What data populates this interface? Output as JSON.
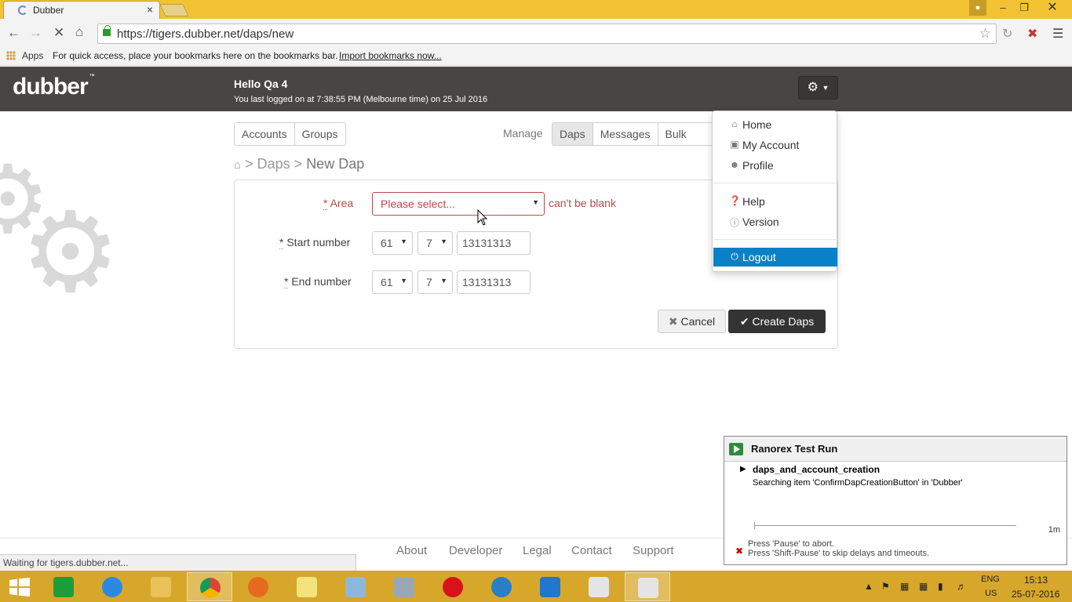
{
  "browser": {
    "tab_title": "Dubber",
    "tab_close": "×",
    "url": "https://tigers.dubber.net/daps/new",
    "bookmarks": {
      "apps_label": "Apps",
      "hint": "For quick access, place your bookmarks here on the bookmarks bar.",
      "import_link": "Import bookmarks now..."
    },
    "status_text": "Waiting for tigers.dubber.net..."
  },
  "header": {
    "logo": "dubber",
    "logo_tm": "™",
    "greeting": "Hello Qa 4",
    "last_login": "You last logged on at 7:38:55 PM (Melbourne time) on 25 Jul 2016"
  },
  "subnav": {
    "left_group": [
      "Accounts",
      "Groups"
    ],
    "manage_label": "Manage",
    "right_group": [
      {
        "label": "Daps",
        "active": true
      },
      {
        "label": "Messages",
        "active": false
      },
      {
        "label": "Bulk Man",
        "active": false
      }
    ]
  },
  "breadcrumb": {
    "sep1": ">",
    "parent": "Daps",
    "sep2": ">",
    "current": "New Dap"
  },
  "form": {
    "area": {
      "label": "Area",
      "required_mark": "*",
      "placeholder": "Please select...",
      "error": "can't be blank"
    },
    "start": {
      "label": "Start number",
      "required_mark": "*",
      "country": "61",
      "area_code": "7",
      "number": "13131313"
    },
    "end": {
      "label": "End number",
      "required_mark": "*",
      "country": "61",
      "area_code": "7",
      "number": "13131313"
    },
    "cancel_label": "Cancel",
    "create_label": "Create Daps"
  },
  "menu": {
    "items": [
      {
        "label": "Home",
        "icon": "home-icon"
      },
      {
        "label": "My Account",
        "icon": "briefcase-icon"
      },
      {
        "label": "Profile",
        "icon": "user-icon"
      },
      {
        "label": "Help",
        "icon": "question-icon"
      },
      {
        "label": "Version",
        "icon": "info-icon"
      },
      {
        "label": "Logout",
        "icon": "power-icon"
      }
    ]
  },
  "footer": {
    "links": [
      "About",
      "Developer",
      "Legal",
      "Contact",
      "Support"
    ]
  },
  "ranorex": {
    "title": "Ranorex Test Run",
    "test_case": "daps_and_account_creation",
    "message": "Searching item 'ConfirmDapCreationButton' in 'Dubber'",
    "duration": "1m",
    "hint1": "Press 'Pause' to abort.",
    "hint2": "Press 'Shift-Pause' to skip delays and timeouts."
  },
  "taskbar": {
    "lang_top": "ENG",
    "lang_bottom": "US",
    "time": "15:13",
    "date": "25-07-2016"
  },
  "colors": {
    "header_bg": "#4a4545",
    "error": "#b94a48",
    "menu_highlight": "#0a81c6",
    "create_button": "#333333",
    "taskbar": "#d7a72b",
    "chrome_titlebar": "#f2c232"
  }
}
